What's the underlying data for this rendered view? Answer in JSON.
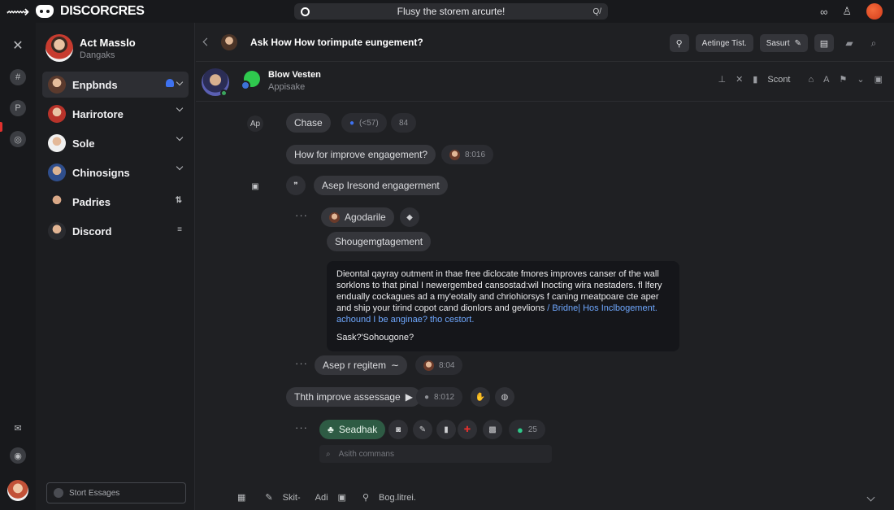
{
  "app": {
    "brand": "DISCORCRES"
  },
  "search": {
    "text": "Flusy the storem arcurte!",
    "right": "Q/"
  },
  "top_right": {
    "icon1": "∞",
    "icon2": "♙"
  },
  "user": {
    "name": "Act Masslo",
    "status": "Dangaks"
  },
  "channels": [
    {
      "label": "Enpbnds",
      "active": true
    },
    {
      "label": "Harirotore"
    },
    {
      "label": "Sole"
    },
    {
      "label": "Chinosigns"
    },
    {
      "label": "Padries"
    },
    {
      "label": "Discord"
    }
  ],
  "start_box": "Stort Essages",
  "chat": {
    "title": "Ask How How torimpute eungement?"
  },
  "header_actions": {
    "btn1": "Aetinge Tist.",
    "btn2": "Sasurt"
  },
  "sub": {
    "name": "Blow Vesten",
    "sub": "Appisake",
    "scont": "Scont"
  },
  "thread": {
    "ap": "Ap",
    "chase": "Chase",
    "chase_meta": "(<57)",
    "chase_num": "84",
    "question": "How for improve engagement?",
    "question_time": "8:016",
    "respond": "Asep Iresond engagerment",
    "agodarile": "Agodarile",
    "shoug": "Shougemgtagement",
    "bubble": {
      "l1": "Dieontal qayray outment in thae free diclocate fmores improves canser of the wall",
      "l2": "sorklons to that pinal I newergembed cansostad:wil Inocting wira nestaders. fl lfery",
      "l3": "endually cockagues ad a my'eotally and chriohiorsys f caning rneatpoare cte aper",
      "l4a": "and ship your tirind copot cand dionlors and gevlions ",
      "l4b": "/ Bridne| Hos Inclbogement.",
      "l5": "achound I be anginae? tho cestort.",
      "sig": "Sask?'Sohougone?"
    },
    "regitem": "Asep r regitem",
    "regitem_meta": "8:04",
    "improve": "Thth improve assessage",
    "improve_time": "8:012",
    "feedback": "Seadhak",
    "count": "25",
    "input_placeholder": "Asith commans"
  },
  "bottom": {
    "b1": "Skit-",
    "b2": "Adi",
    "b3": "Bog.litrei."
  }
}
